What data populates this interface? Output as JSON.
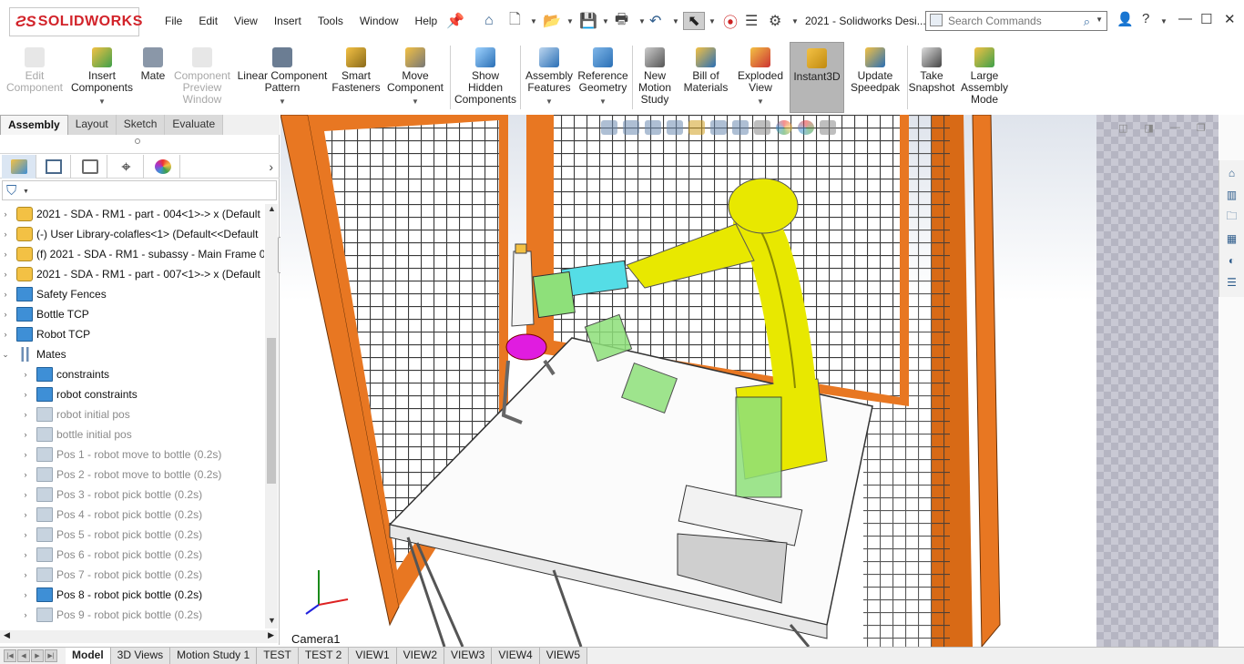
{
  "app": {
    "brand": "SOLIDWORKS",
    "document_title": "2021 - Solidworks Desi..."
  },
  "menu": [
    "File",
    "Edit",
    "View",
    "Insert",
    "Tools",
    "Window",
    "Help"
  ],
  "search": {
    "placeholder": "Search Commands"
  },
  "ribbon": [
    {
      "label": "Edit Component",
      "enabled": false,
      "icon": "edit-component-icon"
    },
    {
      "label": "Insert Components",
      "enabled": true,
      "icon": "insert-components-icon",
      "dropdown": true
    },
    {
      "label": "Mate",
      "enabled": true,
      "icon": "mate-icon"
    },
    {
      "label": "Component Preview Window",
      "enabled": false,
      "icon": "component-preview-icon"
    },
    {
      "label": "Linear Component Pattern",
      "enabled": true,
      "icon": "linear-pattern-icon",
      "dropdown": true
    },
    {
      "label": "Smart Fasteners",
      "enabled": true,
      "icon": "smart-fasteners-icon"
    },
    {
      "label": "Move Component",
      "enabled": true,
      "icon": "move-component-icon",
      "dropdown": true
    },
    {
      "label": "Show Hidden Components",
      "enabled": true,
      "icon": "show-hidden-icon"
    },
    {
      "label": "Assembly Features",
      "enabled": true,
      "icon": "assembly-features-icon",
      "dropdown": true
    },
    {
      "label": "Reference Geometry",
      "enabled": true,
      "icon": "reference-geometry-icon",
      "dropdown": true
    },
    {
      "label": "New Motion Study",
      "enabled": true,
      "icon": "motion-study-icon"
    },
    {
      "label": "Bill of Materials",
      "enabled": true,
      "icon": "bom-icon"
    },
    {
      "label": "Exploded View",
      "enabled": true,
      "icon": "exploded-view-icon",
      "dropdown": true
    },
    {
      "label": "Instant3D",
      "enabled": true,
      "icon": "instant3d-icon",
      "active": true
    },
    {
      "label": "Update Speedpak",
      "enabled": true,
      "icon": "speedpak-icon"
    },
    {
      "label": "Take Snapshot",
      "enabled": true,
      "icon": "snapshot-icon"
    },
    {
      "label": "Large Assembly Mode",
      "enabled": true,
      "icon": "large-assembly-icon"
    }
  ],
  "command_tabs": [
    "Assembly",
    "Layout",
    "Sketch",
    "Evaluate"
  ],
  "selected_command_tab": "Assembly",
  "tree": [
    {
      "label": "2021 - SDA - RM1 - part - 004<1>-> x (Default",
      "type": "part",
      "suppressed": false
    },
    {
      "label": "(-) User Library-colafles<1> (Default<<Default",
      "type": "part",
      "suppressed": false
    },
    {
      "label": "(f) 2021 - SDA - RM1 - subassy - Main Frame 0",
      "type": "part",
      "suppressed": false
    },
    {
      "label": "2021 - SDA - RM1 - part - 007<1>-> x (Default",
      "type": "part",
      "suppressed": false
    },
    {
      "label": "Safety Fences",
      "type": "folder",
      "suppressed": false
    },
    {
      "label": "Bottle TCP",
      "type": "folder",
      "suppressed": false
    },
    {
      "label": "Robot TCP",
      "type": "folder",
      "suppressed": false
    },
    {
      "label": "Mates",
      "type": "mates",
      "suppressed": false,
      "expanded": true
    },
    {
      "label": "constraints",
      "type": "folder",
      "suppressed": false,
      "child": true
    },
    {
      "label": "robot constraints",
      "type": "folder",
      "suppressed": false,
      "child": true
    },
    {
      "label": "robot initial pos",
      "type": "folder",
      "suppressed": true,
      "child": true
    },
    {
      "label": "bottle initial pos",
      "type": "folder",
      "suppressed": true,
      "child": true
    },
    {
      "label": "Pos 1 - robot move to bottle (0.2s)",
      "type": "folder",
      "suppressed": true,
      "child": true
    },
    {
      "label": "Pos 2 - robot move to bottle (0.2s)",
      "type": "folder",
      "suppressed": true,
      "child": true
    },
    {
      "label": "Pos 3 - robot pick bottle (0.2s)",
      "type": "folder",
      "suppressed": true,
      "child": true
    },
    {
      "label": "Pos 4 - robot pick bottle (0.2s)",
      "type": "folder",
      "suppressed": true,
      "child": true
    },
    {
      "label": "Pos 5 - robot pick bottle (0.2s)",
      "type": "folder",
      "suppressed": true,
      "child": true
    },
    {
      "label": "Pos 6 - robot pick bottle (0.2s)",
      "type": "folder",
      "suppressed": true,
      "child": true
    },
    {
      "label": "Pos 7 - robot pick bottle (0.2s)",
      "type": "folder",
      "suppressed": true,
      "child": true
    },
    {
      "label": "Pos 8 - robot pick bottle (0.2s)",
      "type": "folder",
      "suppressed": false,
      "child": true
    },
    {
      "label": "Pos 9 - robot pick bottle (0.2s)",
      "type": "folder",
      "suppressed": true,
      "child": true
    }
  ],
  "viewport": {
    "camera_label": "Camera1"
  },
  "bottom_tabs": [
    "Model",
    "3D Views",
    "Motion Study 1",
    "TEST",
    "TEST 2",
    "VIEW1",
    "VIEW2",
    "VIEW3",
    "VIEW4",
    "VIEW5"
  ],
  "selected_bottom_tab": "Model",
  "colors": {
    "fence_orange": "#e87722",
    "robot_yellow": "#e8e800",
    "gripper_green": "#8ee07a",
    "bottle_holder_magenta": "#e01ce0",
    "accent_red": "#d2232a"
  }
}
